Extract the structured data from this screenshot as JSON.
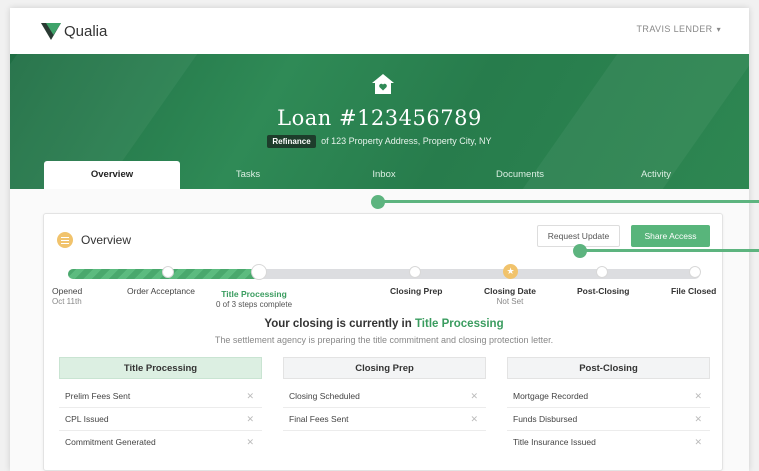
{
  "app": {
    "logo_text": "Qualia",
    "user_name": "TRAVIS LENDER"
  },
  "loan": {
    "title": "Loan #123456789",
    "type_badge": "Refinance",
    "address": "of 123 Property Address, Property City, NY"
  },
  "tabs": [
    {
      "label": "Overview",
      "active": true
    },
    {
      "label": "Tasks",
      "active": false
    },
    {
      "label": "Inbox",
      "active": false
    },
    {
      "label": "Documents",
      "active": false
    },
    {
      "label": "Activity",
      "active": false
    }
  ],
  "overview": {
    "title": "Overview",
    "request_update_label": "Request Update",
    "share_access_label": "Share Access"
  },
  "progress": {
    "steps": [
      {
        "label": "Opened",
        "sub": "Oct 11th"
      },
      {
        "label": "Order Acceptance",
        "sub": ""
      },
      {
        "label": "Title Processing",
        "sub": "0 of 3 steps complete"
      },
      {
        "label": "Closing Prep",
        "sub": ""
      },
      {
        "label": "Closing Date",
        "sub": "Not Set"
      },
      {
        "label": "Post-Closing",
        "sub": ""
      },
      {
        "label": "File Closed",
        "sub": ""
      }
    ]
  },
  "status": {
    "prefix": "Your closing is currently in",
    "stage": "Title Processing",
    "note": "The settlement agency is preparing the title commitment and closing protection letter."
  },
  "columns": [
    {
      "title": "Title Processing",
      "active": true,
      "items": [
        "Prelim Fees Sent",
        "CPL Issued",
        "Commitment Generated"
      ]
    },
    {
      "title": "Closing Prep",
      "active": false,
      "items": [
        "Closing Scheduled",
        "Final Fees Sent"
      ]
    },
    {
      "title": "Post-Closing",
      "active": false,
      "items": [
        "Mortgage Recorded",
        "Funds Disbursed",
        "Title Insurance Issued"
      ]
    }
  ],
  "colors": {
    "brand_green": "#2f8a56",
    "accent_green": "#58b57b",
    "star_yellow": "#f1c36c"
  }
}
